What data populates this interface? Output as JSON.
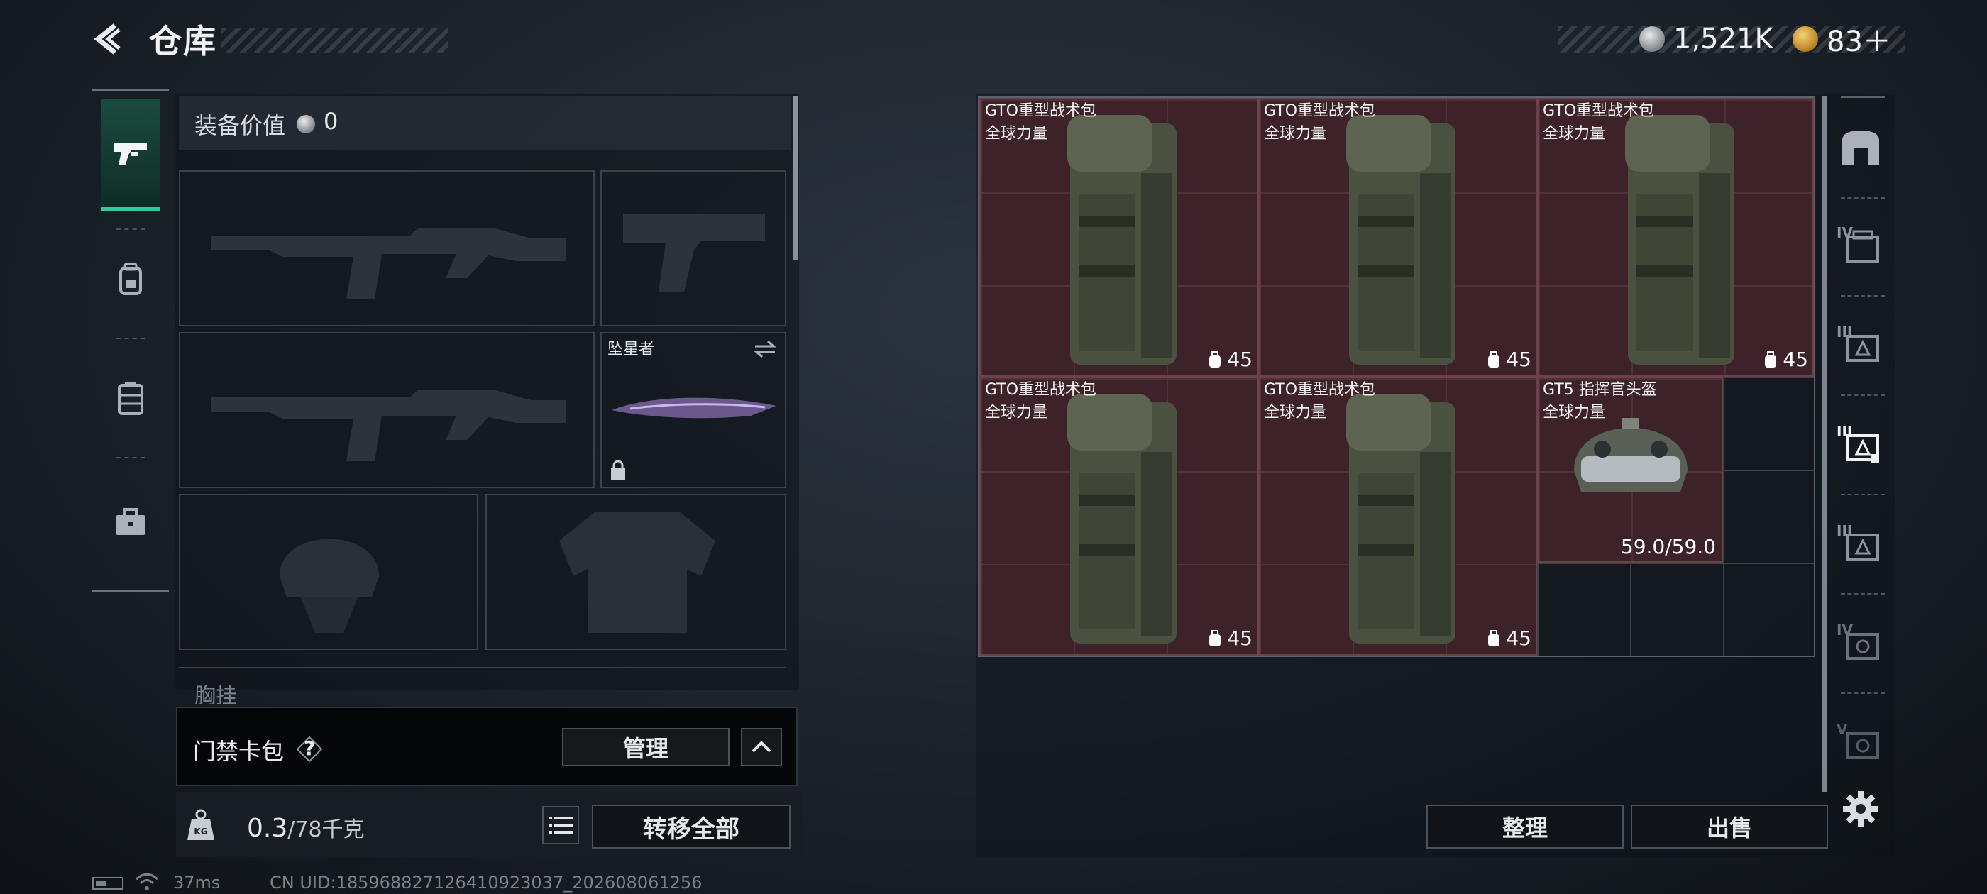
{
  "header": {
    "title": "仓库"
  },
  "currency": [
    {
      "icon": "silver-coin-icon",
      "amount": "1,521K"
    },
    {
      "icon": "gold-triangle-icon",
      "amount": "83＋"
    }
  ],
  "left_tabs": [
    {
      "icon": "pistol-icon"
    },
    {
      "icon": "backpack-icon"
    },
    {
      "icon": "vest-icon"
    },
    {
      "icon": "briefcase-icon"
    }
  ],
  "equipment": {
    "value_label": "装备价值",
    "value": "0",
    "melee_name": "坠星者",
    "chest_label": "胸挂"
  },
  "card_pack": {
    "label": "门禁卡包",
    "help": "?",
    "manage": "管理"
  },
  "weight": {
    "current": "0.3",
    "max": "/78千克",
    "move_all": "转移全部"
  },
  "storage_items": [
    {
      "name": "GTO重型战术包",
      "sub": "全球力量",
      "count": "45"
    },
    {
      "name": "GTO重型战术包",
      "sub": "全球力量",
      "count": "45"
    },
    {
      "name": "GTO重型战术包",
      "sub": "全球力量",
      "count": "45"
    },
    {
      "name": "GTO重型战术包",
      "sub": "全球力量",
      "count": "45"
    },
    {
      "name": "GTO重型战术包",
      "sub": "全球力量",
      "count": "45"
    },
    {
      "name": "GT5 指挥官头盔",
      "sub": "全球力量",
      "durability": "59.0/59.0"
    }
  ],
  "right_tabs": [
    {
      "icon": "safe-box-icon",
      "label": ""
    },
    {
      "icon": "tier-iv-case-icon",
      "label": "IV"
    },
    {
      "icon": "tier-iii-case-icon",
      "label": "III"
    },
    {
      "icon": "tier-iii-case-active-icon",
      "label": "III"
    },
    {
      "icon": "tier-iii-case-icon",
      "label": "III"
    },
    {
      "icon": "tier-iv-safe-icon",
      "label": "IV"
    },
    {
      "icon": "tier-v-safe-icon",
      "label": "V"
    }
  ],
  "actions": {
    "sort": "整理",
    "sell": "出售"
  },
  "status": {
    "ping": "37ms",
    "uid": "CN UID:185968827126410923037_202608061256"
  },
  "colors": {
    "accent": "#37c79a",
    "item_bg": "#3d2329"
  }
}
